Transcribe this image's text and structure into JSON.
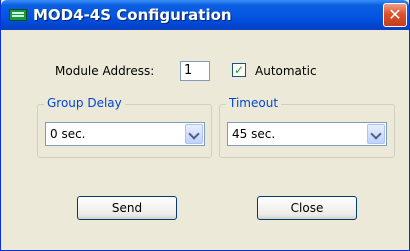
{
  "window": {
    "title": "MOD4-4S Configuration",
    "close_glyph": "✕"
  },
  "module_address": {
    "label": "Module Address:",
    "value": "1"
  },
  "automatic": {
    "label": "Automatic",
    "checked": true,
    "mark": "✓"
  },
  "group_delay": {
    "title": "Group Delay",
    "selected": "0 sec."
  },
  "timeout": {
    "title": "Timeout",
    "selected": "45 sec."
  },
  "buttons": {
    "send": "Send",
    "close": "Close"
  }
}
